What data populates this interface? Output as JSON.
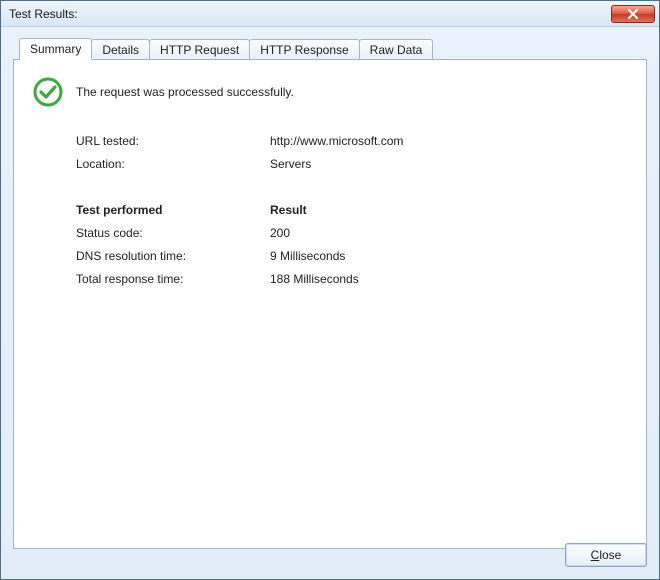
{
  "window": {
    "title": "Test Results:"
  },
  "tabs": {
    "summary": "Summary",
    "details": "Details",
    "http_request": "HTTP Request",
    "http_response": "HTTP Response",
    "raw_data": "Raw Data",
    "active": "summary"
  },
  "status": {
    "icon": "success-checkmark",
    "message": "The request was processed successfully."
  },
  "info": {
    "url_tested_label": "URL tested:",
    "url_tested_value": "http://www.microsoft.com",
    "location_label": "Location:",
    "location_value": "Servers"
  },
  "results": {
    "header_test": "Test performed",
    "header_result": "Result",
    "rows": [
      {
        "label": "Status code:",
        "value": "200"
      },
      {
        "label": "DNS resolution time:",
        "value": "9 Milliseconds"
      },
      {
        "label": "Total response time:",
        "value": "188 Milliseconds"
      }
    ]
  },
  "buttons": {
    "close": "Close"
  }
}
